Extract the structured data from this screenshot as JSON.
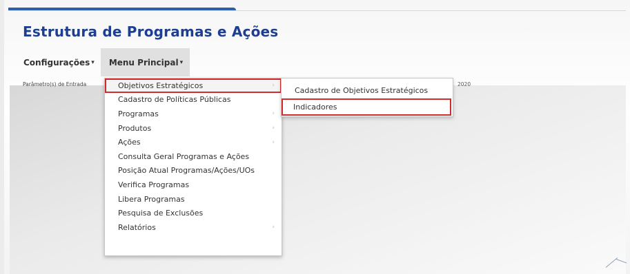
{
  "page": {
    "title": "Estrutura de Programas e Ações"
  },
  "menubar": {
    "items": [
      {
        "label": "Configurações",
        "caret": "▾"
      },
      {
        "label": "Menu Principal",
        "caret": "▾"
      }
    ]
  },
  "params": {
    "label": "Parâmetro(s) de Entrada",
    "year": "2020"
  },
  "dropdown": {
    "items": [
      {
        "label": "Objetivos Estratégicos",
        "has_submenu": true
      },
      {
        "label": "Cadastro de Políticas Públicas",
        "has_submenu": false
      },
      {
        "label": "Programas",
        "has_submenu": true
      },
      {
        "label": "Produtos",
        "has_submenu": true
      },
      {
        "label": "Ações",
        "has_submenu": true
      },
      {
        "label": "Consulta Geral Programas e Ações",
        "has_submenu": false
      },
      {
        "label": "Posição Atual Programas/Ações/UOs",
        "has_submenu": false
      },
      {
        "label": "Verifica Programas",
        "has_submenu": false
      },
      {
        "label": "Libera Programas",
        "has_submenu": false
      },
      {
        "label": "Pesquisa de Exclusões",
        "has_submenu": false
      },
      {
        "label": "Relatórios",
        "has_submenu": true
      }
    ],
    "chevron": "›"
  },
  "submenu": {
    "items": [
      {
        "label": "Cadastro de Objetivos Estratégicos"
      },
      {
        "label": "Indicadores"
      }
    ]
  },
  "colors": {
    "title": "#1e3f8f",
    "accent_bar": "#2e5fa7",
    "highlight_box": "#d12b2b"
  }
}
